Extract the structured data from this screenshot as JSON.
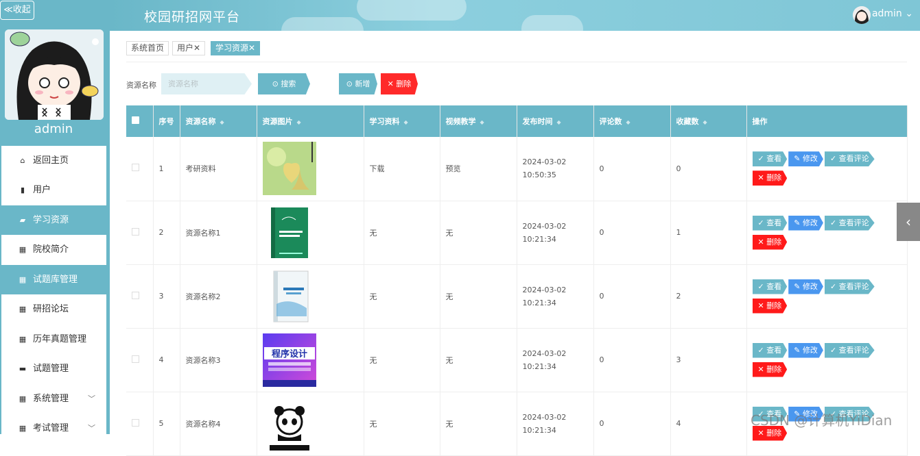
{
  "app": {
    "title": "校园研招网平台",
    "user": "admin"
  },
  "sidebar": {
    "collapse_label": "≪收起",
    "username": "admin",
    "items": [
      {
        "label": "返回主页",
        "icon": "home-icon",
        "active": false
      },
      {
        "label": "用户",
        "icon": "user-file-icon",
        "active": false
      },
      {
        "label": "学习资源",
        "icon": "book-icon",
        "active": true
      },
      {
        "label": "院校简介",
        "icon": "grid-icon",
        "active": false
      },
      {
        "label": "试题库管理",
        "icon": "grid-icon",
        "active": true
      },
      {
        "label": "研招论坛",
        "icon": "grid-icon",
        "active": false
      },
      {
        "label": "历年真题管理",
        "icon": "grid-icon",
        "active": false
      },
      {
        "label": "试题管理",
        "icon": "briefcase-icon",
        "active": false
      },
      {
        "label": "系统管理",
        "icon": "grid-icon",
        "active": false,
        "expandable": true
      },
      {
        "label": "考试管理",
        "icon": "grid-icon",
        "active": false,
        "expandable": true
      }
    ]
  },
  "tabs": [
    {
      "label": "系统首页"
    },
    {
      "label": "用户✕"
    },
    {
      "label": "学习资源✕"
    }
  ],
  "search": {
    "label": "资源名称",
    "placeholder": "资源名称",
    "button": "搜索"
  },
  "toolbar": {
    "add": "新增",
    "delete": "删除"
  },
  "table": {
    "columns": [
      "序号",
      "资源名称",
      "资源图片",
      "学习资料",
      "视频教学",
      "发布时间",
      "评论数",
      "收藏数",
      "操作"
    ],
    "rows": [
      {
        "no": "1",
        "name": "考研资料",
        "material": "下载",
        "video": "预览",
        "time": "2024-03-02 10:50:35",
        "comments": "0",
        "favorites": "0",
        "linked": true,
        "img": "heart"
      },
      {
        "no": "2",
        "name": "资源名称1",
        "material": "无",
        "video": "无",
        "time": "2024-03-02 10:21:34",
        "comments": "0",
        "favorites": "1",
        "linked": false,
        "img": "greenbook"
      },
      {
        "no": "3",
        "name": "资源名称2",
        "material": "无",
        "video": "无",
        "time": "2024-03-02 10:21:34",
        "comments": "0",
        "favorites": "2",
        "linked": false,
        "img": "whitebook"
      },
      {
        "no": "4",
        "name": "资源名称3",
        "material": "无",
        "video": "无",
        "time": "2024-03-02 10:21:34",
        "comments": "0",
        "favorites": "3",
        "linked": false,
        "img": "program"
      },
      {
        "no": "5",
        "name": "资源名称4",
        "material": "无",
        "video": "无",
        "time": "2024-03-02 10:21:34",
        "comments": "0",
        "favorites": "4",
        "linked": false,
        "img": "panda"
      }
    ],
    "actions": {
      "view": "查看",
      "edit": "修改",
      "view_comments": "查看评论",
      "delete": "删除"
    }
  },
  "watermark": "CSDN @计算机YiDian",
  "colors": {
    "accent": "#6ab7c8",
    "danger": "#ff2a2a",
    "edit": "#4a97ef",
    "link": "#2fb36c"
  }
}
